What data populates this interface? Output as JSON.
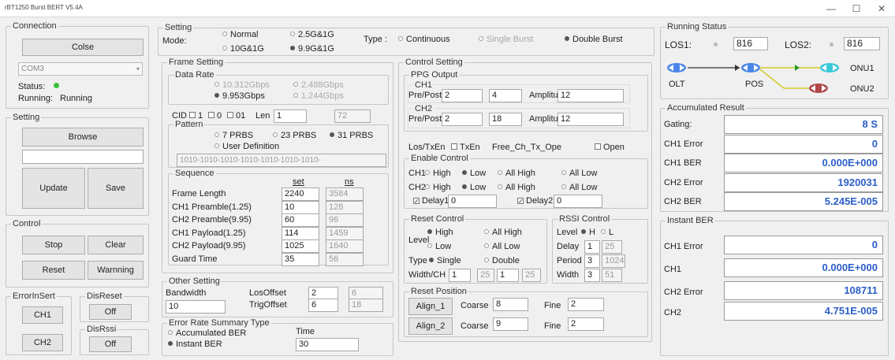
{
  "window": {
    "title": "rBT1250 Burst BERT V5.4A",
    "min": "—",
    "max": "☐",
    "close": "✕"
  },
  "connection": {
    "legend": "Connection",
    "close_label": "Colse",
    "port": "COM3",
    "status_label": "Status:",
    "running_label": "Running:",
    "running_value": "Running"
  },
  "left_setting": {
    "legend": "Setting",
    "browse": "Browse",
    "update": "Update",
    "save": "Save"
  },
  "control": {
    "legend": "Control",
    "stop": "Stop",
    "clear": "Clear",
    "reset": "Reset",
    "warnning": "Warnning"
  },
  "error_insert": {
    "legend": "ErrorInSert",
    "ch1": "CH1",
    "ch2": "CH2",
    "disreset_legend": "DisReset",
    "disreset_btn": "Off",
    "disrssi_legend": "DisRssi",
    "disrssi_btn": "Off"
  },
  "top_setting": {
    "legend": "Setting",
    "mode_label": "Mode:",
    "modes": [
      "Normal",
      "2.5G&1G",
      "10G&1G",
      "9.9G&1G"
    ],
    "type_label": "Type :",
    "types": [
      "Continuous",
      "Single Burst",
      "Double Burst"
    ]
  },
  "frame": {
    "legend": "Frame Setting",
    "data_rate_legend": "Data Rate",
    "rates": [
      "10.312Gbps",
      "2.488Gbps",
      "9.953Gbps",
      "1.244Gbps"
    ],
    "cid_label": "CID",
    "cid_opts": [
      "1",
      "0",
      "01"
    ],
    "len_label": "Len",
    "len_value": "1",
    "len_ns": "72",
    "pattern_legend": "Pattern",
    "patterns": [
      "7 PRBS",
      "23 PRBS",
      "31 PRBS",
      "User Definition"
    ],
    "user_def": "1010-1010-1010-1010-1010-1010-1010-",
    "seq_legend": "Sequence",
    "col_set": "set",
    "col_ns": "ns",
    "rows": [
      {
        "label": "Frame Length",
        "set": "2240",
        "ns": "3584"
      },
      {
        "label": "CH1 Preamble(1.25)",
        "set": "10",
        "ns": "128"
      },
      {
        "label": "CH2 Preamble(9.95)",
        "set": "60",
        "ns": "96"
      },
      {
        "label": "CH1 Payload(1.25)",
        "set": "114",
        "ns": "1459"
      },
      {
        "label": "CH2 Payload(9.95)",
        "set": "1025",
        "ns": "1640"
      },
      {
        "label": "Guard Time",
        "set": "35",
        "ns": "56"
      }
    ]
  },
  "other": {
    "legend": "Other Setting",
    "bandwidth_label": "Bandwidth",
    "bandwidth": "10",
    "los_label": "LosOffset",
    "los": "2",
    "los_ro": "6",
    "trig_label": "TrigOffset",
    "trig": "6",
    "trig_ro": "18"
  },
  "ers": {
    "legend": "Error Rate Summary Type",
    "acc": "Accumulated BER",
    "inst": "Instant BER",
    "time_label": "Time",
    "time": "30"
  },
  "control_setting": {
    "legend": "Control Setting",
    "ppg_legend": "PPG Output",
    "ch1_legend": "CH1",
    "ch2_legend": "CH2",
    "prepost_label": "Pre/Post",
    "amp_label": "Amplitude",
    "ch1_pre": "2",
    "ch1_post": "4",
    "ch1_amp": "12",
    "ch2_pre": "2",
    "ch2_post": "18",
    "ch2_amp": "12",
    "los_tx": "Los/TxEn",
    "txen": "TxEn",
    "free": "Free_Ch_Tx_Ope",
    "open": "Open"
  },
  "enable": {
    "legend": "Enable Control",
    "ch1": "CH1",
    "ch2": "CH2",
    "opts": [
      "High",
      "Low",
      "All High",
      "All Low"
    ],
    "delay1_label": "Delay1",
    "delay1": "0",
    "delay2_label": "Delay2",
    "delay2": "0"
  },
  "reset_ctrl": {
    "legend": "Reset Control",
    "level_label": "Level",
    "opts": [
      "High",
      "All High",
      "Low",
      "All Low"
    ],
    "type_label": "Type",
    "type_opts": [
      "Single",
      "Double"
    ],
    "width_label": "Width/CH",
    "w1": "1",
    "w1_ro": "25",
    "w2": "1",
    "w2_ro": "25"
  },
  "rssi": {
    "legend": "RSSI Control",
    "level_label": "Level",
    "h": "H",
    "l": "L",
    "delay_label": "Delay",
    "delay": "1",
    "delay_ro": "25",
    "period_label": "Period",
    "period": "3",
    "period_ro": "1024",
    "width_label": "Width",
    "width": "3",
    "width_ro": "51"
  },
  "reset_pos": {
    "legend": "Reset Position",
    "align1": "Align_1",
    "align2": "Align_2",
    "coarse_label": "Coarse",
    "fine_label": "Fine",
    "c1": "8",
    "f1": "2",
    "c2": "9",
    "f2": "2"
  },
  "running": {
    "legend": "Running Status",
    "los1_label": "LOS1:",
    "los1": "816",
    "los2_label": "LOS2:",
    "los2": "816",
    "olt": "OLT",
    "pos": "POS",
    "onu1": "ONU1",
    "onu2": "ONU2"
  },
  "accumulated": {
    "legend": "Accumulated Result",
    "rows": [
      {
        "label": "Gating:",
        "value": "8 S"
      },
      {
        "label": "CH1 Error",
        "value": "0"
      },
      {
        "label": "CH1 BER",
        "value": "0.000E+000"
      },
      {
        "label": "CH2 Error",
        "value": "1920031"
      },
      {
        "label": "CH2 BER",
        "value": "5.245E-005"
      }
    ]
  },
  "instant": {
    "legend": "Instant BER",
    "rows": [
      {
        "label": "CH1 Error",
        "value": "0"
      },
      {
        "label": "CH1",
        "value": "0.000E+000"
      },
      {
        "label": "CH2 Error",
        "value": "108711"
      },
      {
        "label": "CH2",
        "value": "4.751E-005"
      }
    ]
  },
  "colors": {
    "value_blue": "#2c5ec8",
    "led_green": "#3cbf3c"
  }
}
